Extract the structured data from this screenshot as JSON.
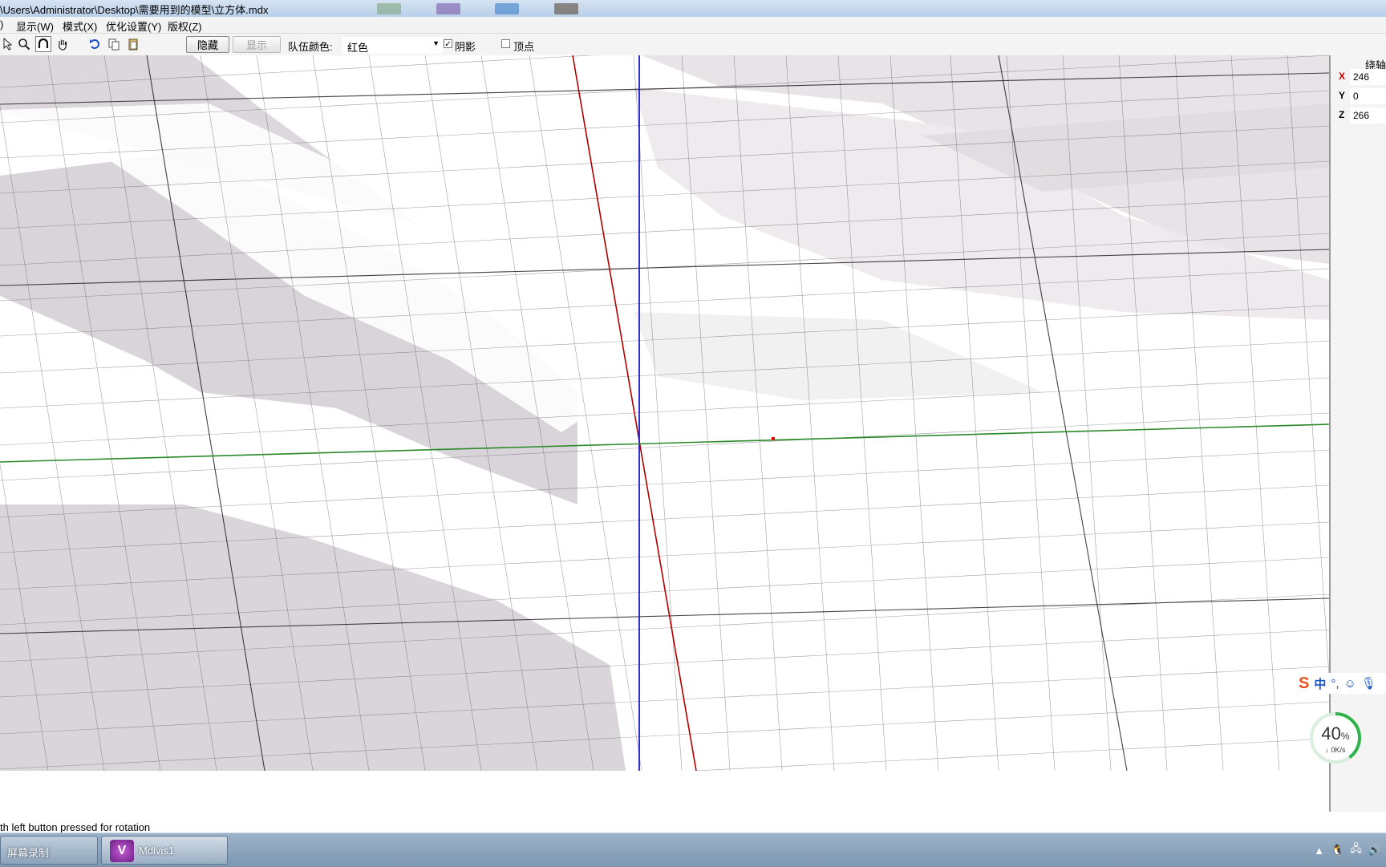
{
  "window": {
    "title": "\\Users\\Administrator\\Desktop\\需要用到的模型\\立方体.mdx"
  },
  "menu": {
    "items": [
      "显示(W)",
      "模式(X)",
      "优化设置(Y)",
      "版权(Z)"
    ]
  },
  "toolbar": {
    "hide_label": "隐藏",
    "show_label": "显示",
    "team_color_label": "队伍颜色:",
    "team_color_value": "红色",
    "shadow_label": "阴影",
    "shadow_checked": true,
    "vertex_label": "顶点",
    "vertex_checked": false,
    "icons": [
      "select-arrow-icon",
      "zoom-icon",
      "rotate-icon",
      "pan-hand-icon",
      "undo-icon",
      "copy-icon",
      "paste-icon"
    ]
  },
  "panel": {
    "header": "绕轴",
    "x_label": "X",
    "x_value": "246",
    "y_label": "Y",
    "y_value": "0",
    "z_label": "Z",
    "z_value": "266"
  },
  "status": {
    "text": "th left button pressed for rotation"
  },
  "ime": {
    "mode": "中",
    "punct": "°,"
  },
  "network": {
    "percent": "40",
    "percent_fraction": 0.4,
    "percent_sign": "%",
    "speed": "↓ 0K/s"
  },
  "taskbar": {
    "tasks": [
      "屏幕录制",
      "Mdlvis1"
    ]
  },
  "colors": {
    "x_axis": "#b00000",
    "y_axis": "#2a8a2a",
    "z_axis": "#1a1acc",
    "grid": "#444444",
    "accent_ring": "#2fb34a"
  }
}
